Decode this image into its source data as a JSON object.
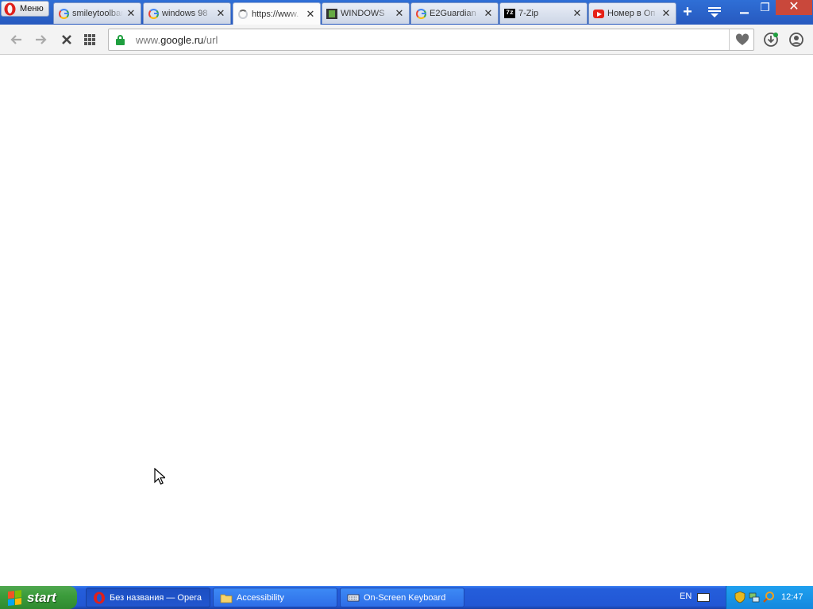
{
  "browser": {
    "menu_label": "Меню",
    "tabs": [
      {
        "title": "smileytoolbar",
        "icon": "google-icon",
        "active": false
      },
      {
        "title": "windows 98",
        "icon": "google-icon",
        "active": false
      },
      {
        "title": "https://www.",
        "icon": "loading-spinner-icon",
        "active": true
      },
      {
        "title": "WINDOWS",
        "icon": "film-icon",
        "active": false
      },
      {
        "title": "E2Guardian",
        "icon": "google-icon",
        "active": false
      },
      {
        "title": "7-Zip",
        "icon": "sevenzip-icon",
        "active": false
      },
      {
        "title": "Номер в Оп",
        "icon": "youtube-icon",
        "active": false
      }
    ],
    "new_tab_label": "+",
    "tab_close_glyph": "✕",
    "window_controls": {
      "minimize": "▁",
      "maximize": "❐",
      "close": "✕"
    }
  },
  "address_bar": {
    "host_prefix": "www.",
    "host": "google.ru",
    "path": "/url",
    "secure": true
  },
  "colors": {
    "tabbar": "#2759bf",
    "secure_lock": "#1f9f3f",
    "taskbar": "#245edb",
    "start_button": "#3c9c3c"
  },
  "taskbar": {
    "start_label": "start",
    "items": [
      {
        "label": "Без названия — Opera",
        "icon": "opera-icon",
        "active": true
      },
      {
        "label": "Accessibility",
        "icon": "folder-icon",
        "active": false
      },
      {
        "label": "On-Screen Keyboard",
        "icon": "keyboard-icon",
        "active": false
      }
    ],
    "language": "EN",
    "clock": "12:47"
  }
}
